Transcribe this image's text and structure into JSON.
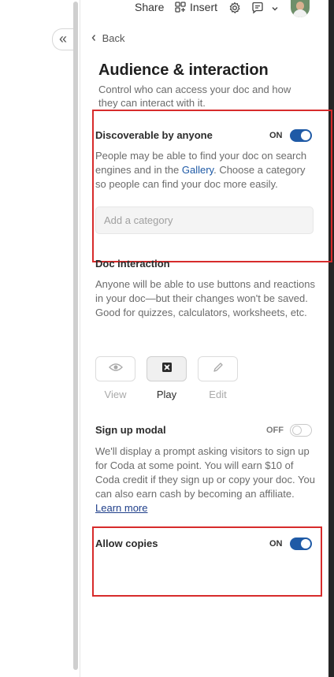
{
  "topbar": {
    "share_label": "Share",
    "insert_label": "Insert",
    "icons": [
      "insert-grid-icon",
      "gear-icon",
      "comment-icon",
      "chevron-down-icon"
    ]
  },
  "nav": {
    "collapse_glyph": "«",
    "back_label": "Back"
  },
  "panel": {
    "title": "Audience & interaction",
    "subtitle": "Control who can access your doc and how they can interact with it."
  },
  "discoverable": {
    "title": "Discoverable by anyone",
    "state_label": "ON",
    "desc_before": "People may be able to find your doc on search engines and in the ",
    "gallery_link": "Gallery",
    "desc_after": ". Choose a category so people can find your doc more easily.",
    "category_placeholder": "Add a category"
  },
  "doc_interaction": {
    "title": "Doc interaction",
    "desc": "Anyone will be able to use buttons and reactions in your doc—but their changes won't be saved. Good for quizzes, calculators, worksheets, etc.",
    "modes": [
      {
        "label": "View",
        "icon": "eye-icon",
        "active": false
      },
      {
        "label": "Play",
        "icon": "play-mode-icon",
        "active": true
      },
      {
        "label": "Edit",
        "icon": "pencil-icon",
        "active": false
      }
    ]
  },
  "signup": {
    "title": "Sign up modal",
    "state_label": "OFF",
    "desc": "We'll display a prompt asking visitors to sign up for Coda at some point. You will earn $10 of Coda credit if they sign up or copy your doc. You can also earn cash by becoming an affiliate. ",
    "learn_more": "Learn more"
  },
  "copies": {
    "title": "Allow copies",
    "state_label": "ON"
  },
  "colors": {
    "toggle_on": "#1f5aa6",
    "highlight": "#d72b2b",
    "link": "#1f5aa6"
  }
}
